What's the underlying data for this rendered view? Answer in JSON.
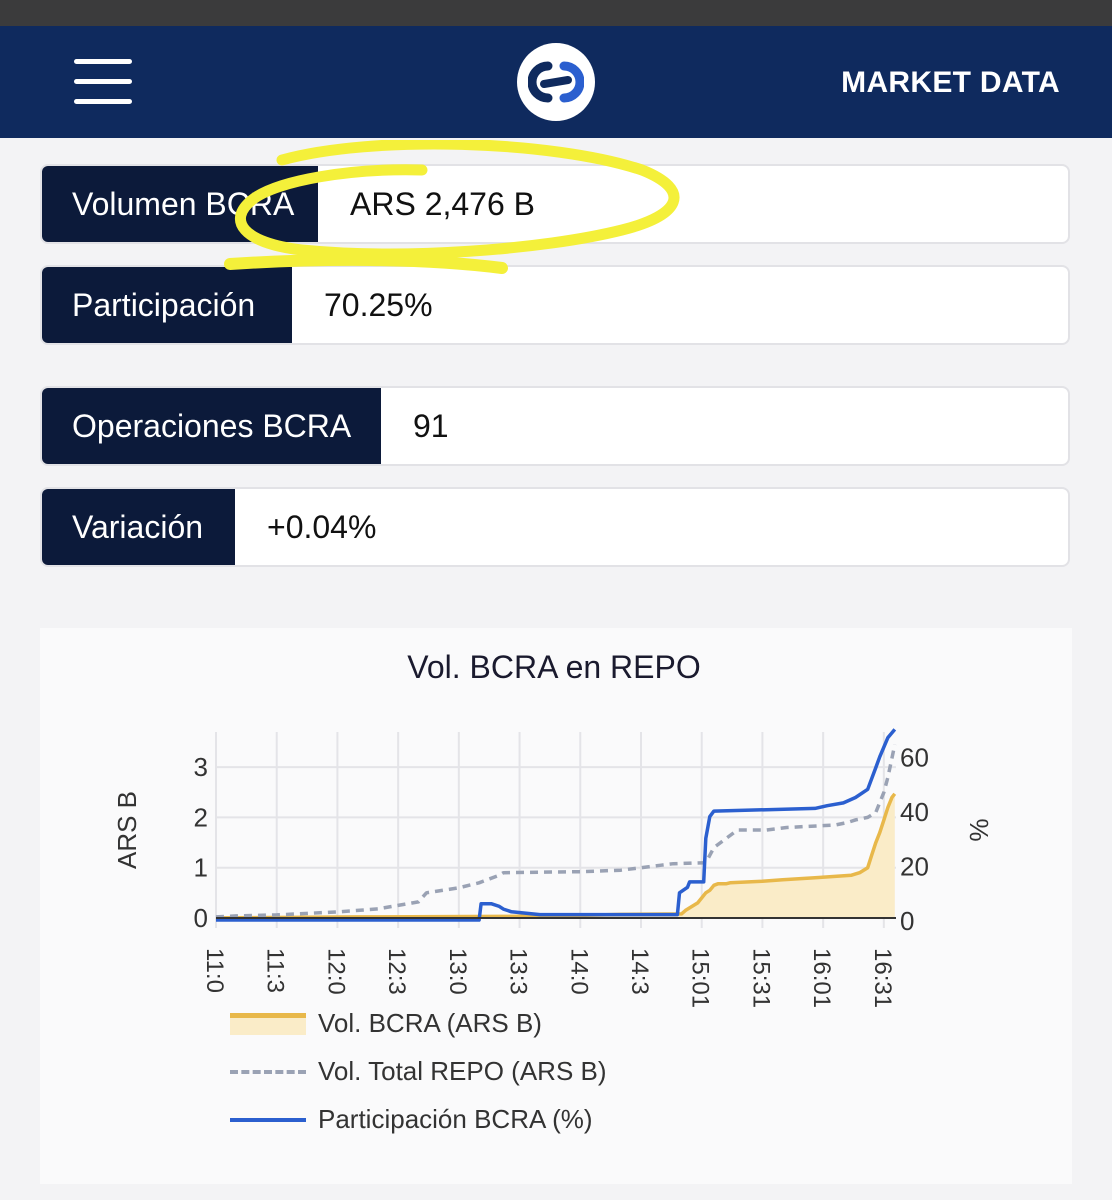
{
  "navbar": {
    "menu_icon": "hamburger-menu-icon",
    "logo_icon": "brand-logo-icon",
    "link_label": "MARKET DATA",
    "bg_color": "#0f2a5e"
  },
  "stats": [
    {
      "label": "Volumen BCRA",
      "value": "ARS 2,476 B"
    },
    {
      "label": "Participación",
      "value": "70.25%"
    },
    {
      "label": "Operaciones BCRA",
      "value": "91"
    },
    {
      "label": "Variación",
      "value": "+0.04%"
    }
  ],
  "highlight_color": "#f4f03a",
  "chart_data": {
    "type": "line",
    "title": "Vol. BCRA en REPO",
    "ylabel": "ARS B",
    "y2label": "%",
    "ylim": [
      -0.2,
      3.7
    ],
    "y2lim": [
      0,
      72
    ],
    "yticks": [
      0,
      1,
      2,
      3
    ],
    "y2ticks": [
      0,
      20,
      40,
      60
    ],
    "xticks": [
      "11:0",
      "11:3",
      "12:0",
      "12:3",
      "13:0",
      "13:3",
      "14:0",
      "14:3",
      "15:01",
      "15:31",
      "16:01",
      "16:31"
    ],
    "grid": true,
    "legend_position": "bottom",
    "series": [
      {
        "name": "Vol. BCRA (ARS B)",
        "axis": "left",
        "color": "#e8b84a",
        "style": "area",
        "points": [
          [
            0,
            0
          ],
          [
            3.5,
            0.02
          ],
          [
            7,
            0.03
          ],
          [
            8.6,
            0.04
          ],
          [
            9,
            0.05
          ],
          [
            9.5,
            0.06
          ],
          [
            10,
            0.07
          ],
          [
            11.5,
            0.08
          ],
          [
            11.6,
            0.15
          ],
          [
            11.9,
            0.3
          ],
          [
            12.1,
            0.5
          ],
          [
            12.2,
            0.55
          ],
          [
            12.3,
            0.65
          ],
          [
            12.4,
            0.68
          ],
          [
            12.6,
            0.68
          ],
          [
            12.7,
            0.7
          ],
          [
            13.5,
            0.73
          ],
          [
            14,
            0.76
          ],
          [
            14.8,
            0.8
          ],
          [
            15.7,
            0.85
          ],
          [
            15.9,
            0.9
          ],
          [
            16.1,
            1.0
          ],
          [
            16.2,
            1.25
          ],
          [
            16.3,
            1.5
          ],
          [
            16.4,
            1.7
          ],
          [
            16.5,
            1.95
          ],
          [
            16.6,
            2.2
          ],
          [
            16.7,
            2.4
          ],
          [
            16.77,
            2.47
          ]
        ]
      },
      {
        "name": "Vol. Total REPO (ARS B)",
        "axis": "left",
        "color": "#9aa2b4",
        "style": "dashed",
        "points": [
          [
            0,
            0.02
          ],
          [
            0.5,
            0.04
          ],
          [
            1.5,
            0.06
          ],
          [
            3,
            0.12
          ],
          [
            4,
            0.18
          ],
          [
            4.5,
            0.25
          ],
          [
            5,
            0.32
          ],
          [
            5.2,
            0.5
          ],
          [
            6,
            0.6
          ],
          [
            6.5,
            0.7
          ],
          [
            7,
            0.85
          ],
          [
            7.1,
            0.9
          ],
          [
            8,
            0.91
          ],
          [
            9,
            0.92
          ],
          [
            10,
            0.95
          ],
          [
            10.5,
            1.0
          ],
          [
            11,
            1.05
          ],
          [
            11.3,
            1.08
          ],
          [
            12.1,
            1.1
          ],
          [
            12.3,
            1.4
          ],
          [
            12.8,
            1.7
          ],
          [
            12.9,
            1.75
          ],
          [
            13.6,
            1.75
          ],
          [
            14.1,
            1.8
          ],
          [
            15.3,
            1.85
          ],
          [
            15.6,
            1.9
          ],
          [
            15.8,
            1.95
          ],
          [
            16.1,
            2.0
          ],
          [
            16.3,
            2.1
          ],
          [
            16.5,
            2.5
          ],
          [
            16.6,
            2.8
          ],
          [
            16.77,
            3.45
          ]
        ]
      },
      {
        "name": "Participación BCRA (%)",
        "axis": "right",
        "color": "#2b5fcf",
        "style": "solid",
        "points": [
          [
            0,
            0
          ],
          [
            6.5,
            0
          ],
          [
            6.55,
            6
          ],
          [
            6.8,
            6
          ],
          [
            7,
            5
          ],
          [
            7.1,
            4
          ],
          [
            7.3,
            3
          ],
          [
            8,
            2
          ],
          [
            11.1,
            2
          ],
          [
            11.4,
            2
          ],
          [
            11.45,
            10
          ],
          [
            11.65,
            12
          ],
          [
            11.7,
            14
          ],
          [
            12.05,
            14
          ],
          [
            12.1,
            30
          ],
          [
            12.2,
            38
          ],
          [
            12.3,
            40
          ],
          [
            14.8,
            41
          ],
          [
            15.1,
            42
          ],
          [
            15.5,
            43
          ],
          [
            15.8,
            45
          ],
          [
            16.1,
            48
          ],
          [
            16.3,
            56
          ],
          [
            16.4,
            60
          ],
          [
            16.6,
            67
          ],
          [
            16.77,
            70
          ]
        ]
      }
    ]
  }
}
